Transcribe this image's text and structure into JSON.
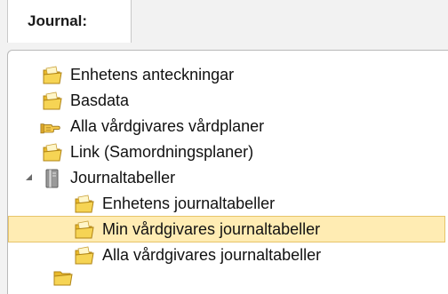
{
  "tab": {
    "label": "Journal:"
  },
  "tree": {
    "items": [
      {
        "label": "Enhetens anteckningar",
        "icon": "folder-icon"
      },
      {
        "label": "Basdata",
        "icon": "folder-icon"
      },
      {
        "label": "Alla vårdgivares vårdplaner",
        "icon": "hand-pointer-icon"
      },
      {
        "label": "Link (Samordningsplaner)",
        "icon": "folder-icon"
      },
      {
        "label": "Journaltabeller",
        "icon": "book-icon",
        "expanded": true
      },
      {
        "label": "Enhetens journaltabeller",
        "icon": "folder-icon"
      },
      {
        "label": "Min vårdgivares journaltabeller",
        "icon": "folder-icon",
        "selected": true
      },
      {
        "label": "Alla vårdgivares journaltabeller",
        "icon": "folder-icon"
      }
    ]
  },
  "colors": {
    "selection_bg": "#ffecb3",
    "selection_border": "#e7c46a",
    "folder": "#f3d24a"
  }
}
